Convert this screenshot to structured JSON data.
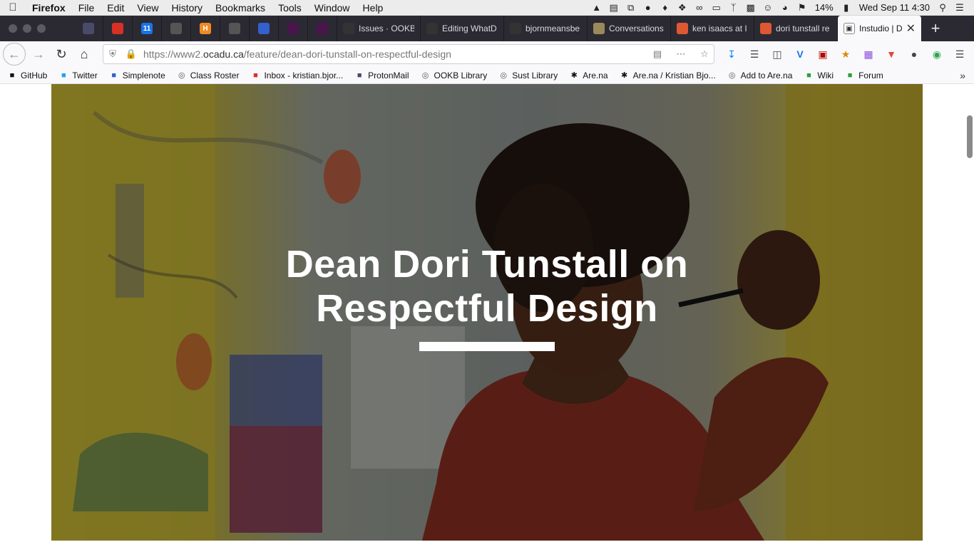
{
  "menubar": {
    "apple_icon": "apple-icon",
    "app_name": "Firefox",
    "menus": [
      "File",
      "Edit",
      "View",
      "History",
      "Bookmarks",
      "Tools",
      "Window",
      "Help"
    ],
    "battery": "14%",
    "datetime": "Wed Sep 11  4:30"
  },
  "tabs": {
    "pinned": [
      {
        "icon": "lock-icon",
        "color": "#4a4a6a"
      },
      {
        "icon": "gmail-icon",
        "color": "#d93025"
      },
      {
        "icon": "calendar-icon",
        "color": "#1a73e8",
        "text": "11"
      },
      {
        "icon": "globe-icon",
        "color": "#555"
      },
      {
        "icon": "h-icon",
        "color": "#f08a24",
        "text": "H"
      },
      {
        "icon": "globe-icon",
        "color": "#555"
      },
      {
        "icon": "simplenote-icon",
        "color": "#3360cc"
      },
      {
        "icon": "slack-icon",
        "color": "#4a154b"
      },
      {
        "icon": "slack-icon",
        "color": "#4a154b"
      }
    ],
    "open": [
      {
        "label": "Issues · OOKB",
        "icon": "github-icon",
        "color": "#333"
      },
      {
        "label": "Editing WhatD",
        "icon": "github-icon",
        "color": "#333"
      },
      {
        "label": "bjornmeansbe",
        "icon": "github-icon",
        "color": "#333"
      },
      {
        "label": "Conversations",
        "icon": "image-icon",
        "color": "#9a8a5a"
      },
      {
        "label": "ken isaacs at I",
        "icon": "duckduckgo-icon",
        "color": "#de5833"
      },
      {
        "label": "dori tunstall re",
        "icon": "duckduckgo-icon",
        "color": "#de5833"
      }
    ],
    "active": {
      "label": "Instudio | D",
      "icon": "page-icon"
    }
  },
  "nav": {
    "url_host": "https://www2.",
    "url_domain": "ocadu.ca",
    "url_path": "/feature/dean-dori-tunstall-on-respectful-design"
  },
  "bookmarks": [
    {
      "label": "GitHub",
      "icon": "github-icon",
      "color": "#111"
    },
    {
      "label": "Twitter",
      "icon": "twitter-icon",
      "color": "#1da1f2"
    },
    {
      "label": "Simplenote",
      "icon": "simplenote-icon",
      "color": "#3360cc"
    },
    {
      "label": "Class Roster",
      "icon": "globe-icon",
      "color": "#555"
    },
    {
      "label": "Inbox - kristian.bjor...",
      "icon": "gmail-icon",
      "color": "#d93025"
    },
    {
      "label": "ProtonMail",
      "icon": "lock-icon",
      "color": "#4a4a6a"
    },
    {
      "label": "OOKB Library",
      "icon": "globe-icon",
      "color": "#555"
    },
    {
      "label": "Sust Library",
      "icon": "globe-icon",
      "color": "#555"
    },
    {
      "label": "Are.na",
      "icon": "arena-icon",
      "color": "#111"
    },
    {
      "label": "Are.na / Kristian Bjo...",
      "icon": "arena-icon",
      "color": "#111"
    },
    {
      "label": "Add to Are.na",
      "icon": "globe-icon",
      "color": "#555"
    },
    {
      "label": "Wiki",
      "icon": "wiki-icon",
      "color": "#2e9e3a"
    },
    {
      "label": "Forum",
      "icon": "forum-icon",
      "color": "#2e9e3a"
    }
  ],
  "hero": {
    "title_line1": "Dean Dori Tunstall on",
    "title_line2": "Respectful Design"
  }
}
